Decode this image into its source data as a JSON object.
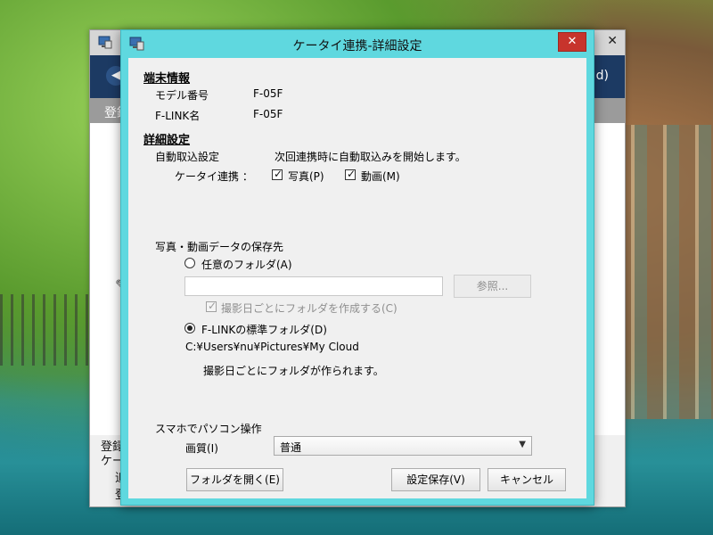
{
  "parent_window": {
    "grey_bar_text": "登録",
    "nav_right_text": "d)",
    "footer_lines": [
      "登録",
      "ケー",
      "追",
      "登"
    ]
  },
  "dialog": {
    "title": "ケータイ連携-詳細設定",
    "close_label": "✕",
    "device_info": {
      "heading": "端末情報",
      "model_label": "モデル番号",
      "model_value": "F-05F",
      "flink_label": "F-LINK名",
      "flink_value": "F-05F"
    },
    "detail": {
      "heading": "詳細設定",
      "auto_import_label": "自動取込設定",
      "auto_import_desc": "次回連携時に自動取込みを開始します。",
      "phone_link_label": "ケータイ連携 ：",
      "photo_label": "写真(P)",
      "photo_checked": true,
      "video_label": "動画(M)",
      "video_checked": true
    },
    "save_dest": {
      "heading": "写真・動画データの保存先",
      "any_folder_label": "任意のフォルダ(A)",
      "any_folder_selected": false,
      "folder_path_value": "",
      "browse_label": "参照...",
      "create_by_date_label": "撮影日ごとにフォルダを作成する(C)",
      "create_by_date_checked": true,
      "standard_folder_label": "F-LINKの標準フォルダ(D)",
      "standard_folder_selected": true,
      "standard_path": "C:¥Users¥nu¥Pictures¥My Cloud",
      "standard_note": "撮影日ごとにフォルダが作られます。"
    },
    "smartphone_control": {
      "heading": "スマホでパソコン操作",
      "quality_label": "画質(I)",
      "quality_value": "普通"
    },
    "buttons": {
      "open_folder": "フォルダを開く(E)",
      "save_settings": "設定保存(V)",
      "cancel": "キャンセル"
    }
  }
}
